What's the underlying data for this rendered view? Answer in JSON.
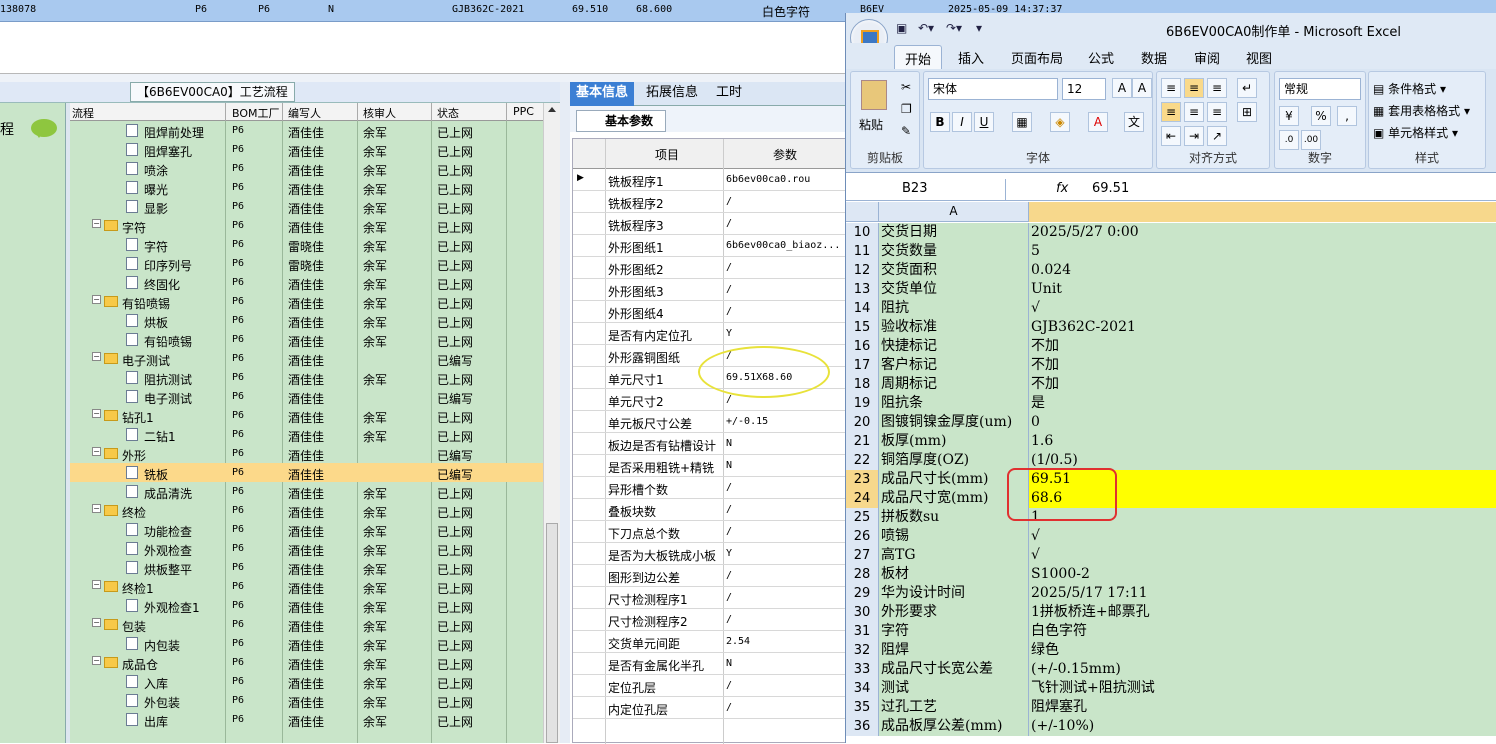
{
  "topbar": {
    "cells": [
      "138078",
      "P6",
      "P6",
      "N",
      "GJB362C-2021",
      "69.510",
      "68.600",
      "白色字符",
      "B6EV",
      "2025-05-09 14:37:37"
    ]
  },
  "left": {
    "label": "程",
    "panel_title": "【6B6EV00CA0】工艺流程"
  },
  "tree": {
    "headers": [
      "流程",
      "BOM工厂",
      "编写人",
      "核审人",
      "状态",
      "PPC"
    ],
    "rows": [
      {
        "type": "doc",
        "level": 2,
        "name": "阻焊前处理",
        "bom": "P6",
        "writer": "酒佳佳",
        "reviewer": "余军",
        "status": "已上网"
      },
      {
        "type": "doc",
        "level": 2,
        "name": "阻焊塞孔",
        "bom": "P6",
        "writer": "酒佳佳",
        "reviewer": "余军",
        "status": "已上网"
      },
      {
        "type": "doc",
        "level": 2,
        "name": "喷涂",
        "bom": "P6",
        "writer": "酒佳佳",
        "reviewer": "余军",
        "status": "已上网"
      },
      {
        "type": "doc",
        "level": 2,
        "name": "曝光",
        "bom": "P6",
        "writer": "酒佳佳",
        "reviewer": "余军",
        "status": "已上网"
      },
      {
        "type": "doc",
        "level": 2,
        "name": "显影",
        "bom": "P6",
        "writer": "酒佳佳",
        "reviewer": "余军",
        "status": "已上网"
      },
      {
        "type": "folder",
        "level": 1,
        "name": "字符",
        "bom": "P6",
        "writer": "酒佳佳",
        "reviewer": "余军",
        "status": "已上网"
      },
      {
        "type": "doc",
        "level": 2,
        "name": "字符",
        "bom": "P6",
        "writer": "雷晓佳",
        "reviewer": "余军",
        "status": "已上网"
      },
      {
        "type": "doc",
        "level": 2,
        "name": "印序列号",
        "bom": "P6",
        "writer": "雷晓佳",
        "reviewer": "余军",
        "status": "已上网"
      },
      {
        "type": "doc",
        "level": 2,
        "name": "终固化",
        "bom": "P6",
        "writer": "酒佳佳",
        "reviewer": "余军",
        "status": "已上网"
      },
      {
        "type": "folder",
        "level": 1,
        "name": "有铅喷锡",
        "bom": "P6",
        "writer": "酒佳佳",
        "reviewer": "余军",
        "status": "已上网"
      },
      {
        "type": "doc",
        "level": 2,
        "name": "烘板",
        "bom": "P6",
        "writer": "酒佳佳",
        "reviewer": "余军",
        "status": "已上网"
      },
      {
        "type": "doc",
        "level": 2,
        "name": "有铅喷锡",
        "bom": "P6",
        "writer": "酒佳佳",
        "reviewer": "余军",
        "status": "已上网"
      },
      {
        "type": "folder",
        "level": 1,
        "name": "电子测试",
        "bom": "P6",
        "writer": "酒佳佳",
        "reviewer": "",
        "status": "已编写"
      },
      {
        "type": "doc",
        "level": 2,
        "name": "阻抗测试",
        "bom": "P6",
        "writer": "酒佳佳",
        "reviewer": "余军",
        "status": "已上网"
      },
      {
        "type": "doc",
        "level": 2,
        "name": "电子测试",
        "bom": "P6",
        "writer": "酒佳佳",
        "reviewer": "",
        "status": "已编写"
      },
      {
        "type": "folder",
        "level": 1,
        "name": "钻孔1",
        "bom": "P6",
        "writer": "酒佳佳",
        "reviewer": "余军",
        "status": "已上网"
      },
      {
        "type": "doc",
        "level": 2,
        "name": "二钻1",
        "bom": "P6",
        "writer": "酒佳佳",
        "reviewer": "余军",
        "status": "已上网"
      },
      {
        "type": "folder",
        "level": 1,
        "name": "外形",
        "bom": "P6",
        "writer": "酒佳佳",
        "reviewer": "",
        "status": "已编写"
      },
      {
        "type": "doc",
        "level": 2,
        "name": "铣板",
        "bom": "P6",
        "writer": "酒佳佳",
        "reviewer": "",
        "status": "已编写",
        "selected": true
      },
      {
        "type": "doc",
        "level": 2,
        "name": "成品清洗",
        "bom": "P6",
        "writer": "酒佳佳",
        "reviewer": "余军",
        "status": "已上网"
      },
      {
        "type": "folder",
        "level": 1,
        "name": "终检",
        "bom": "P6",
        "writer": "酒佳佳",
        "reviewer": "余军",
        "status": "已上网"
      },
      {
        "type": "doc",
        "level": 2,
        "name": "功能检查",
        "bom": "P6",
        "writer": "酒佳佳",
        "reviewer": "余军",
        "status": "已上网"
      },
      {
        "type": "doc",
        "level": 2,
        "name": "外观检查",
        "bom": "P6",
        "writer": "酒佳佳",
        "reviewer": "余军",
        "status": "已上网"
      },
      {
        "type": "doc",
        "level": 2,
        "name": "烘板整平",
        "bom": "P6",
        "writer": "酒佳佳",
        "reviewer": "余军",
        "status": "已上网"
      },
      {
        "type": "folder",
        "level": 1,
        "name": "终检1",
        "bom": "P6",
        "writer": "酒佳佳",
        "reviewer": "余军",
        "status": "已上网"
      },
      {
        "type": "doc",
        "level": 2,
        "name": "外观检查1",
        "bom": "P6",
        "writer": "酒佳佳",
        "reviewer": "余军",
        "status": "已上网"
      },
      {
        "type": "folder",
        "level": 1,
        "name": "包装",
        "bom": "P6",
        "writer": "酒佳佳",
        "reviewer": "余军",
        "status": "已上网"
      },
      {
        "type": "doc",
        "level": 2,
        "name": "内包装",
        "bom": "P6",
        "writer": "酒佳佳",
        "reviewer": "余军",
        "status": "已上网"
      },
      {
        "type": "folder",
        "level": 1,
        "name": "成品仓",
        "bom": "P6",
        "writer": "酒佳佳",
        "reviewer": "余军",
        "status": "已上网"
      },
      {
        "type": "doc",
        "level": 2,
        "name": "入库",
        "bom": "P6",
        "writer": "酒佳佳",
        "reviewer": "余军",
        "status": "已上网"
      },
      {
        "type": "doc",
        "level": 2,
        "name": "外包装",
        "bom": "P6",
        "writer": "酒佳佳",
        "reviewer": "余军",
        "status": "已上网"
      },
      {
        "type": "doc",
        "level": 2,
        "name": "出库",
        "bom": "P6",
        "writer": "酒佳佳",
        "reviewer": "余军",
        "status": "已上网"
      }
    ]
  },
  "params": {
    "tabs": [
      "基本信息",
      "拓展信息",
      "工时"
    ],
    "subtab": "基本参数",
    "headers": [
      "项目",
      "参数"
    ],
    "rows": [
      {
        "k": "铣板程序1",
        "v": "6b6ev00ca0.rou"
      },
      {
        "k": "铣板程序2",
        "v": "/"
      },
      {
        "k": "铣板程序3",
        "v": "/"
      },
      {
        "k": "外形图纸1",
        "v": "6b6ev00ca0_biaoz..."
      },
      {
        "k": "外形图纸2",
        "v": "/"
      },
      {
        "k": "外形图纸3",
        "v": "/"
      },
      {
        "k": "外形图纸4",
        "v": "/"
      },
      {
        "k": "是否有内定位孔",
        "v": "Y"
      },
      {
        "k": "外形露铜图纸",
        "v": "/"
      },
      {
        "k": "单元尺寸1",
        "v": "69.51X68.60"
      },
      {
        "k": "单元尺寸2",
        "v": "/"
      },
      {
        "k": "单元板尺寸公差",
        "v": "+/-0.15"
      },
      {
        "k": "板边是否有钻槽设计",
        "v": "N"
      },
      {
        "k": "是否采用粗铣+精铣",
        "v": "N"
      },
      {
        "k": "异形槽个数",
        "v": "/"
      },
      {
        "k": "叠板块数",
        "v": "/"
      },
      {
        "k": "下刀点总个数",
        "v": "/"
      },
      {
        "k": "是否为大板铣成小板",
        "v": "Y"
      },
      {
        "k": "图形到边公差",
        "v": "/"
      },
      {
        "k": "尺寸检测程序1",
        "v": "/"
      },
      {
        "k": "尺寸检测程序2",
        "v": "/"
      },
      {
        "k": "交货单元间距",
        "v": "2.54"
      },
      {
        "k": "是否有金属化半孔",
        "v": "N"
      },
      {
        "k": "定位孔层",
        "v": "/"
      },
      {
        "k": "内定位孔层",
        "v": "/"
      }
    ]
  },
  "excel": {
    "title": "6B6EV00CA0制作单 - Microsoft Excel",
    "tabs": [
      "开始",
      "插入",
      "页面布局",
      "公式",
      "数据",
      "审阅",
      "视图"
    ],
    "groups": [
      "剪贴板",
      "字体",
      "对齐方式",
      "数字",
      "样式"
    ],
    "paste": "粘贴",
    "font": "宋体",
    "size": "12",
    "number_format": "常规",
    "styles": [
      "条件格式",
      "套用表格格式",
      "单元格样式"
    ],
    "namebox": "B23",
    "formula": "69.51",
    "col_a": "A",
    "rows": [
      {
        "n": "10",
        "a": "交货日期",
        "b": "2025/5/27 0:00"
      },
      {
        "n": "11",
        "a": "交货数量",
        "b": "5"
      },
      {
        "n": "12",
        "a": "交货面积",
        "b": "0.024"
      },
      {
        "n": "13",
        "a": "交货单位",
        "b": "Unit"
      },
      {
        "n": "14",
        "a": "阻抗",
        "b": "√"
      },
      {
        "n": "15",
        "a": "验收标准",
        "b": "GJB362C-2021"
      },
      {
        "n": "16",
        "a": "快捷标记",
        "b": "不加"
      },
      {
        "n": "17",
        "a": "客户标记",
        "b": "不加"
      },
      {
        "n": "18",
        "a": "周期标记",
        "b": "不加"
      },
      {
        "n": "19",
        "a": "阻抗条",
        "b": "是"
      },
      {
        "n": "20",
        "a": "图镀铜镍金厚度(um)",
        "b": "0"
      },
      {
        "n": "21",
        "a": "板厚(mm)",
        "b": "1.6"
      },
      {
        "n": "22",
        "a": "铜箔厚度(OZ)",
        "b": "(1/0.5)"
      },
      {
        "n": "23",
        "a": "成品尺寸长(mm)",
        "b": "69.51",
        "hl": true
      },
      {
        "n": "24",
        "a": "成品尺寸宽(mm)",
        "b": "68.6",
        "hl": true
      },
      {
        "n": "25",
        "a": "拼板数su",
        "b": "1"
      },
      {
        "n": "26",
        "a": "喷锡",
        "b": "√"
      },
      {
        "n": "27",
        "a": "高TG",
        "b": "√"
      },
      {
        "n": "28",
        "a": "板材",
        "b": "S1000-2"
      },
      {
        "n": "29",
        "a": "华为设计时间",
        "b": "2025/5/17 17:11"
      },
      {
        "n": "30",
        "a": "外形要求",
        "b": "1拼板桥连+邮票孔"
      },
      {
        "n": "31",
        "a": "字符",
        "b": "白色字符"
      },
      {
        "n": "32",
        "a": "阻焊",
        "b": "绿色"
      },
      {
        "n": "33",
        "a": "成品尺寸长宽公差",
        "b": "(+/-0.15mm)"
      },
      {
        "n": "34",
        "a": "测试",
        "b": "飞针测试+阻抗测试"
      },
      {
        "n": "35",
        "a": "过孔工艺",
        "b": "阻焊塞孔"
      },
      {
        "n": "36",
        "a": "成品板厚公差(mm)",
        "b": "(+/-10%)"
      }
    ]
  }
}
